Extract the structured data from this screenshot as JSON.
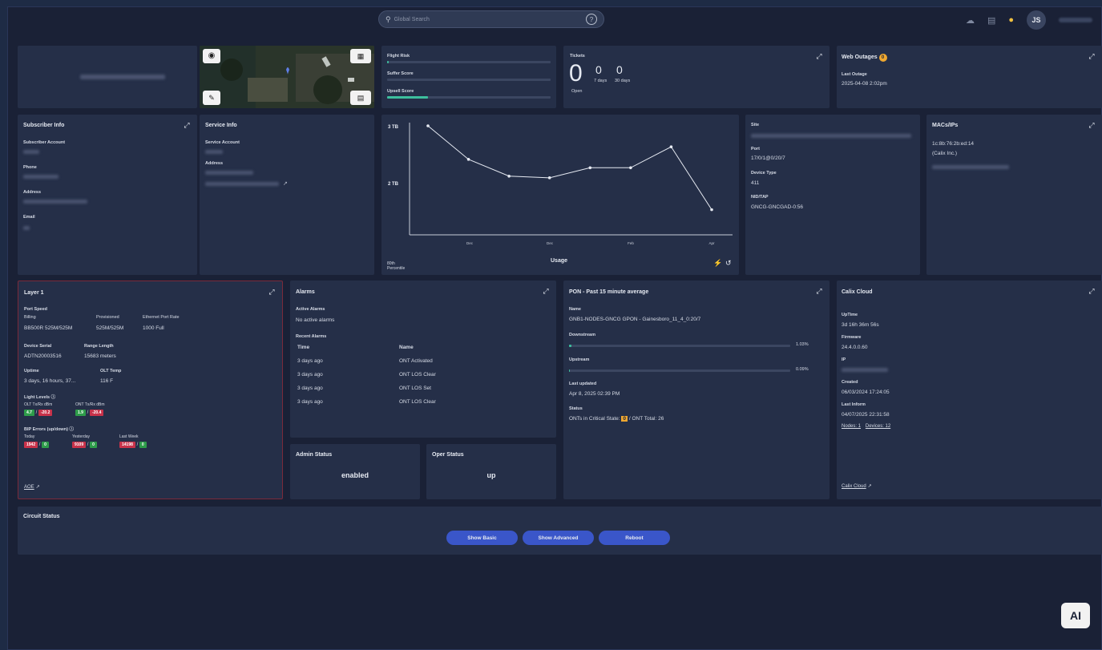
{
  "search": {
    "placeholder": "Global Search"
  },
  "user": {
    "initials": "JS"
  },
  "summary": {
    "flight_risk_label": "Flight Risk",
    "suffer_score_label": "Suffer Score",
    "upsell_score_label": "Upsell Score",
    "upsell_fill": 0.25
  },
  "tickets": {
    "title": "Tickets",
    "open": "0",
    "open_label": "Open",
    "d7": "0",
    "d7_label": "7 days",
    "d30": "0",
    "d30_label": "30 days"
  },
  "web_outages": {
    "title": "Web Outages",
    "badge": "0",
    "last_label": "Last Outage",
    "last_value": "2025-04-08 2:02pm"
  },
  "subscriber": {
    "title": "Subscriber Info",
    "account_label": "Subscriber Account",
    "phone_label": "Phone",
    "address_label": "Address",
    "email_label": "Email"
  },
  "service": {
    "title": "Service Info",
    "account_label": "Service Account",
    "address_label": "Address"
  },
  "usage": {
    "y_top": "3 TB",
    "y_mid": "2 TB",
    "xlabel": "Usage",
    "footer_left": "80th Percentile",
    "reset_icon": "history-icon",
    "bolt_icon": "bolt-icon"
  },
  "chart_data": {
    "type": "line",
    "title": "",
    "xlabel": "Usage",
    "ylabel": "",
    "categories": [
      "Nov",
      "",
      "Dec",
      "",
      "",
      "Feb",
      "",
      "Apr"
    ],
    "x_tick_labels": [
      "Dec",
      "Dec",
      "Feb",
      "Apr"
    ],
    "values": [
      3.0,
      2.6,
      2.4,
      2.38,
      2.5,
      2.5,
      2.75,
      2.0
    ],
    "ylim": [
      1.7,
      3.0
    ],
    "grid": false
  },
  "site": {
    "site_label": "Site",
    "port_label": "Port",
    "port_value": "17/0/1@0/20/7",
    "device_type_label": "Device Type",
    "device_type_value": "411",
    "nid_label": "NID/TAP",
    "nid_value": "GNCG-GNCGAD-0:56"
  },
  "macs": {
    "title": "MACs/IPs",
    "mac": "1c:8b:76:2b:ed:14",
    "vendor": "(Calix Inc.)"
  },
  "layer1": {
    "title": "Layer 1",
    "port_speed_label": "Port Speed",
    "billing_label": "Billing",
    "billing_value": "BB500R 525M/525M",
    "provisioned_label": "Provisioned",
    "provisioned_value": "525M/525M",
    "eth_label": "Ethernet Port Rate",
    "eth_value": "1000 Full",
    "serial_label": "Device Serial",
    "serial_value": "ADTN20003516",
    "range_label": "Range Length",
    "range_value": "15683 meters",
    "uptime_label": "Uptime",
    "uptime_value": "3 days, 16 hours, 37...",
    "olt_temp_label": "OLT Temp",
    "olt_temp_value": "116 F",
    "light_label": "Light Levels",
    "olt_rx_label": "OLT Tx/Rx dBm",
    "olt_tx": "4.7",
    "olt_rx": "-20.2",
    "ont_rx_label": "ONT Tx/Rx dBm",
    "ont_tx": "1.9",
    "ont_rx": "-20.4",
    "bip_label": "BIP Errors (up/down)",
    "today_label": "Today",
    "today_up": "1942",
    "today_down": "0",
    "yesterday_label": "Yesterday",
    "yest_up": "9109",
    "yest_down": "0",
    "lastweek_label": "Last Week",
    "week_up": "14198",
    "week_down": "0",
    "link": "AOE"
  },
  "alarms": {
    "title": "Alarms",
    "active_label": "Active Alarms",
    "active_value": "No active alarms",
    "recent_label": "Recent Alarms",
    "col_time": "Time",
    "col_name": "Name",
    "rows": [
      {
        "time": "3 days ago",
        "name": "ONT Activated"
      },
      {
        "time": "3 days ago",
        "name": "ONT LOS Clear"
      },
      {
        "time": "3 days ago",
        "name": "ONT LOS Set"
      },
      {
        "time": "3 days ago",
        "name": "ONT LOS Clear"
      }
    ]
  },
  "admin": {
    "title": "Admin Status",
    "value": "enabled"
  },
  "oper": {
    "title": "Oper Status",
    "value": "up"
  },
  "pon": {
    "title": "PON - Past 15 minute average",
    "name_label": "Name",
    "name_value": "GNB1-NODES-GNCG GPON - Gainesboro_11_4_0:20/7",
    "down_label": "Downstream",
    "down_value": "1.03%",
    "down_fill": 0.0103,
    "up_label": "Upstream",
    "up_value": "0.09%",
    "up_fill": 0.0009,
    "updated_label": "Last updated",
    "updated_value": "Apr 8, 2025 02:39 PM",
    "status_label": "Status",
    "status_prefix": "ONTs in Critical State:",
    "critical": "0",
    "status_suffix": "/ ONT Total: 26"
  },
  "calix": {
    "title": "Calix Cloud",
    "uptime_label": "UpTime",
    "uptime_value": "3d 16h 36m 56s",
    "firmware_label": "Firmware",
    "firmware_value": "24.4.0.0.60",
    "ip_label": "IP",
    "created_label": "Created",
    "created_value": "06/03/2024 17:24:05",
    "inform_label": "Last Inform",
    "inform_value": "04/07/2025 22:31:58",
    "nodes": "Nodes: 1",
    "devices": "Devices: 12",
    "link": "Calix Cloud"
  },
  "circuit": {
    "title": "Circuit Status",
    "btn_basic": "Show Basic",
    "btn_advanced": "Show Advanced",
    "btn_reboot": "Reboot"
  },
  "ai_badge": "AI"
}
